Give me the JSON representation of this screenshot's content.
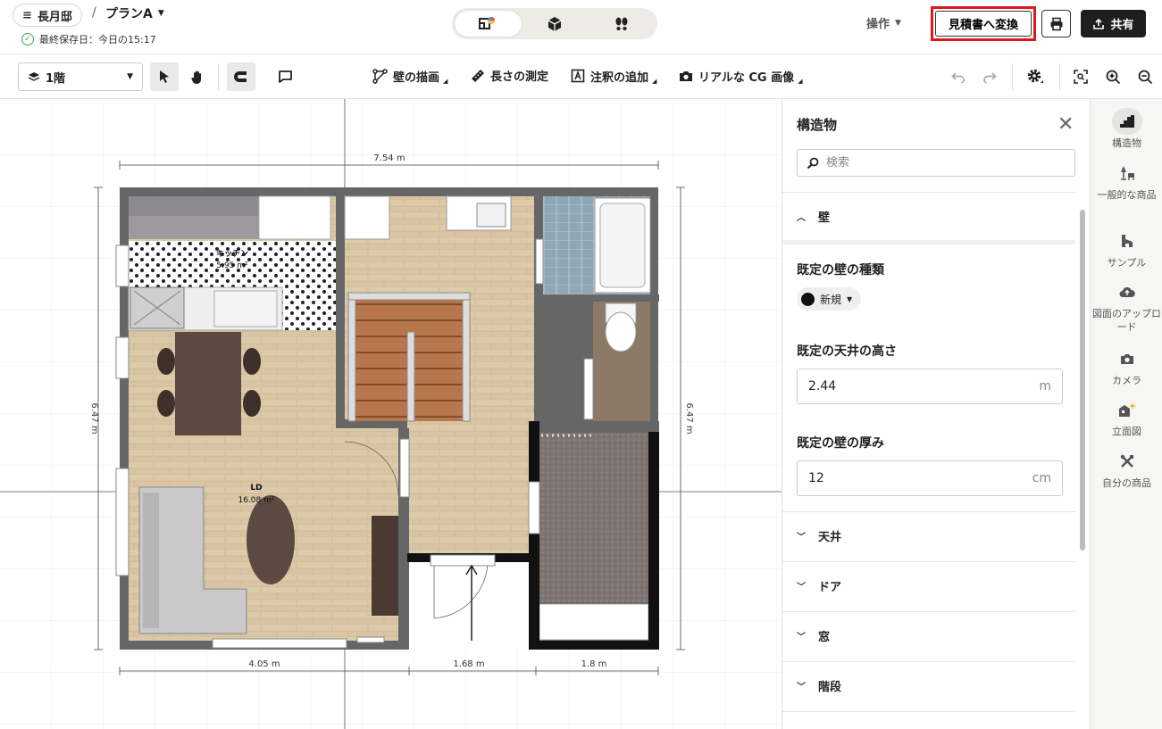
{
  "header": {
    "project_name": "長月邸",
    "breadcrumb_separator": "/",
    "plan_name": "プランA",
    "save_status": "最終保存日：今日の15:17",
    "operations_label": "操作",
    "convert_label": "見積書へ変換",
    "share_label": "共有"
  },
  "toolbar": {
    "floor": "1階",
    "draw_wall": "壁の描画",
    "measure": "長さの測定",
    "add_annotation": "注釈の追加",
    "cg_image": "リアルな CG 画像"
  },
  "plan": {
    "dim_top": "7.54 m",
    "dim_left": "6.47 m",
    "dim_right": "6.47 m",
    "dim_bottom_1": "4.05 m",
    "dim_bottom_2": "1.68 m",
    "dim_bottom_3": "1.8 m",
    "kitchen_name": "キッチン",
    "kitchen_area": "5.95 m²",
    "ld_name": "LD",
    "ld_area": "16.08 m²"
  },
  "panel": {
    "title": "構造物",
    "search_placeholder": "検索",
    "wall_section": "壁",
    "wall_type_label": "既定の壁の種類",
    "wall_type_value": "新規",
    "ceiling_height_label": "既定の天井の高さ",
    "ceiling_height_value": "2.44",
    "ceiling_height_unit": "m",
    "wall_thickness_label": "既定の壁の厚み",
    "wall_thickness_value": "12",
    "wall_thickness_unit": "cm",
    "sections": [
      "天井",
      "ドア",
      "窓",
      "階段"
    ]
  },
  "sidebar": {
    "items": [
      {
        "label": "構造物"
      },
      {
        "label": "一般的な商品"
      },
      {
        "label": "サンプル"
      },
      {
        "label": "図面のアップロード"
      },
      {
        "label": "カメラ"
      },
      {
        "label": "立面図"
      },
      {
        "label": "自分の商品"
      }
    ]
  },
  "colors": {
    "accent_red": "#e0161d",
    "dark": "#1e1e1e",
    "wall": "#6b6b6b",
    "wood_floor": "#d9c4a3"
  }
}
